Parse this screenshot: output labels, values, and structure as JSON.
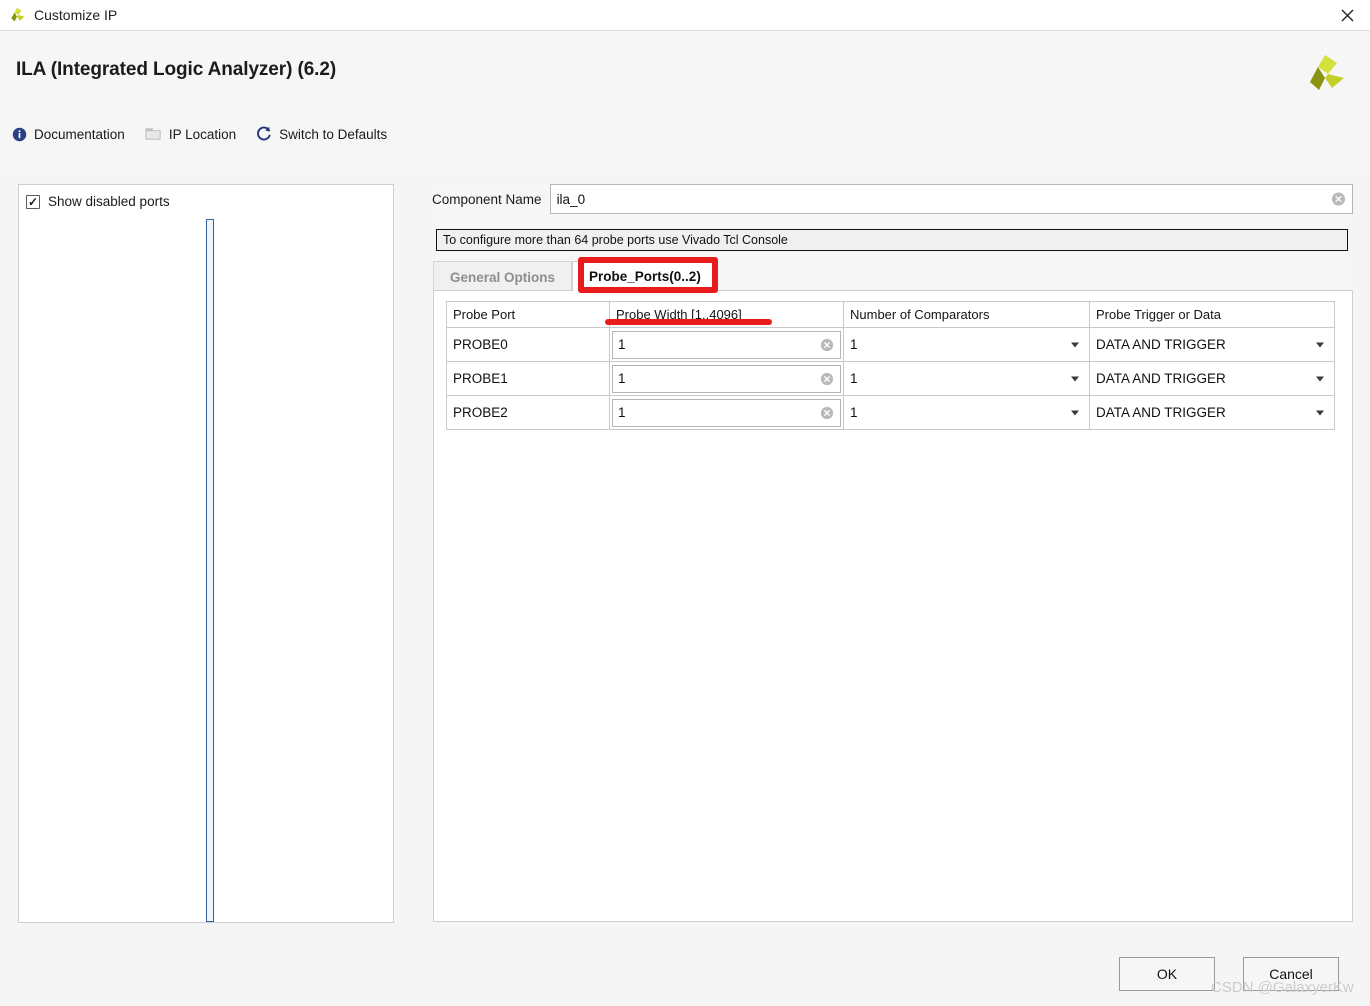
{
  "window": {
    "title": "Customize IP",
    "icon": "xilinx-logo-icon",
    "close_label": "✕"
  },
  "header": {
    "ip_title": "ILA (Integrated Logic Analyzer) (6.2)",
    "logo": "xilinx-logo-icon",
    "links": [
      {
        "label": "Documentation",
        "icon": "info-icon"
      },
      {
        "label": "IP Location",
        "icon": "folder-icon"
      },
      {
        "label": "Switch to Defaults",
        "icon": "refresh-icon"
      }
    ]
  },
  "left_panel": {
    "show_disabled_ports": {
      "label": "Show disabled ports",
      "checked": true,
      "check_glyph": "✓"
    },
    "diagram": {
      "name": "ip-block-diagram"
    }
  },
  "component": {
    "label": "Component Name",
    "value": "ila_0",
    "placeholder": "",
    "clear_icon": "clear-circle-icon"
  },
  "info_bar": {
    "message": "To configure more than 64 probe ports use Vivado Tcl Console"
  },
  "tabs": [
    {
      "label": "General Options",
      "active": false
    },
    {
      "label": "Probe_Ports(0..2)",
      "active": true
    }
  ],
  "table": {
    "columns": [
      "Probe Port",
      "Probe Width [1..4096]",
      "Number of Comparators",
      "Probe Trigger or Data"
    ],
    "rows": [
      {
        "port": "PROBE0",
        "width": "1",
        "comparators": "1",
        "trigger_or_data": "DATA AND TRIGGER"
      },
      {
        "port": "PROBE1",
        "width": "1",
        "comparators": "1",
        "trigger_or_data": "DATA AND TRIGGER"
      },
      {
        "port": "PROBE2",
        "width": "1",
        "comparators": "1",
        "trigger_or_data": "DATA AND TRIGGER"
      }
    ]
  },
  "footer": {
    "ok_label": "OK",
    "cancel_label": "Cancel"
  },
  "watermark": {
    "text": "CSDN @GalaxyerKw"
  },
  "colors": {
    "annotation_red": "#e81c1c",
    "logo_light": "#d6e03c",
    "logo_mid": "#c3d02a",
    "logo_dark": "#8a9410",
    "block_border": "#3a6295",
    "block_fill": "#eef4fa"
  }
}
